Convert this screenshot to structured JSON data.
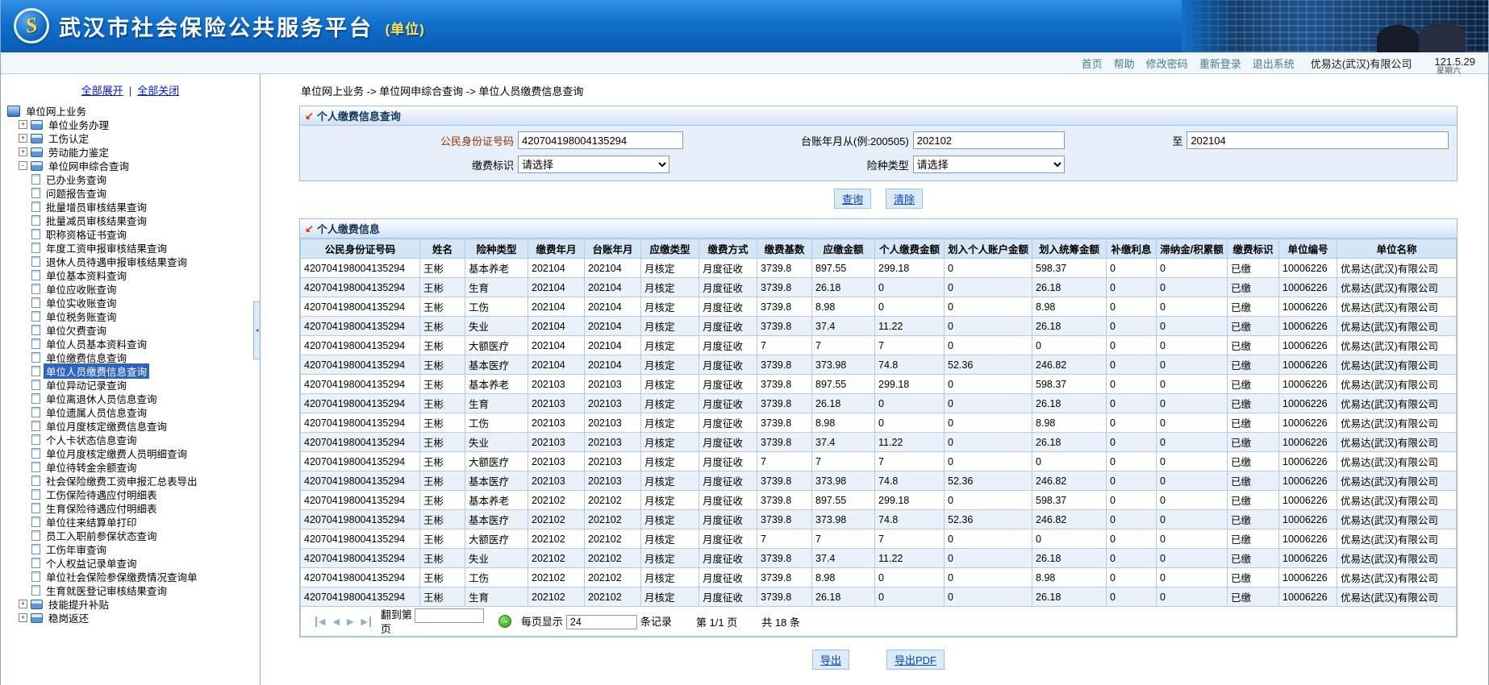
{
  "header": {
    "logo_glyph": "S",
    "title": "武汉市社会保险公共服务平台",
    "title_tag": "(单位)",
    "nav": [
      "首页",
      "帮助",
      "修改密码",
      "重新登录",
      "退出系统"
    ],
    "company": "优易达(武汉)有限公司",
    "version": "121.5.29",
    "weekday": "星期六"
  },
  "sidebar": {
    "expand_all": "全部展开",
    "collapse_all": "全部关闭",
    "root": "单位网上业务",
    "selected_item": "单位人员缴费信息查询",
    "groups": [
      {
        "label": "单位业务办理",
        "expanded": false,
        "children": []
      },
      {
        "label": "工伤认定",
        "expanded": false,
        "children": []
      },
      {
        "label": "劳动能力鉴定",
        "expanded": false,
        "children": []
      },
      {
        "label": "单位网申综合查询",
        "expanded": true,
        "children": [
          "已办业务查询",
          "问题报告查询",
          "批量增员审核结果查询",
          "批量减员审核结果查询",
          "职称资格证书查询",
          "年度工资申报审核结果查询",
          "退休人员待遇申报审核结果查询",
          "单位基本资料查询",
          "单位应收账查询",
          "单位实收账查询",
          "单位税务账查询",
          "单位欠费查询",
          "单位人员基本资料查询",
          "单位缴费信息查询",
          "单位人员缴费信息查询",
          "单位异动记录查询",
          "单位离退休人员信息查询",
          "单位遗属人员信息查询",
          "单位月度核定缴费信息查询",
          "个人卡状态信息查询",
          "单位月度核定缴费人员明细查询",
          "单位待转金余额查询",
          "社会保险缴费工资申报汇总表导出",
          "工伤保险待遇应付明细表",
          "生育保险待遇应付明细表",
          "单位往来结算单打印",
          "员工入职前参保状态查询",
          "工伤年审查询",
          "个人权益记录单查询",
          "单位社会保险参保缴费情况查询单",
          "生育就医登记审核结果查询"
        ]
      },
      {
        "label": "技能提升补贴",
        "expanded": false,
        "children": []
      },
      {
        "label": "稳岗返还",
        "expanded": false,
        "children": []
      }
    ]
  },
  "breadcrumb": {
    "separator": "->",
    "parts": [
      "单位网上业务",
      "单位网申综合查询",
      "单位人员缴费信息查询"
    ]
  },
  "query": {
    "title": "个人缴费信息查询",
    "id_label": "公民身份证号码",
    "id_value": "420704198004135294",
    "period_from_label": "台账年月从(例:200505)",
    "period_from_value": "202102",
    "period_to_label": "至",
    "period_to_value": "202104",
    "pay_flag_label": "缴费标识",
    "pay_flag_value": "请选择",
    "ins_type_label": "险种类型",
    "ins_type_value": "请选择",
    "search_btn": "查询",
    "clear_btn": "清除"
  },
  "results": {
    "title": "个人缴费信息",
    "columns": [
      "公民身份证号码",
      "姓名",
      "险种类型",
      "缴费年月",
      "台账年月",
      "应缴类型",
      "缴费方式",
      "缴费基数",
      "应缴金额",
      "个人缴费金额",
      "划入个人账户金额",
      "划入统筹金额",
      "补缴利息",
      "滞纳金/积累额",
      "缴费标识",
      "单位编号",
      "单位名称"
    ],
    "rows": [
      [
        "420704198004135294",
        "王彬",
        "基本养老",
        "202104",
        "202104",
        "月核定",
        "月度征收",
        "3739.8",
        "897.55",
        "299.18",
        "0",
        "598.37",
        "0",
        "0",
        "已缴",
        "10006226",
        "优易达(武汉)有限公司"
      ],
      [
        "420704198004135294",
        "王彬",
        "生育",
        "202104",
        "202104",
        "月核定",
        "月度征收",
        "3739.8",
        "26.18",
        "0",
        "0",
        "26.18",
        "0",
        "0",
        "已缴",
        "10006226",
        "优易达(武汉)有限公司"
      ],
      [
        "420704198004135294",
        "王彬",
        "工伤",
        "202104",
        "202104",
        "月核定",
        "月度征收",
        "3739.8",
        "8.98",
        "0",
        "0",
        "8.98",
        "0",
        "0",
        "已缴",
        "10006226",
        "优易达(武汉)有限公司"
      ],
      [
        "420704198004135294",
        "王彬",
        "失业",
        "202104",
        "202104",
        "月核定",
        "月度征收",
        "3739.8",
        "37.4",
        "11.22",
        "0",
        "26.18",
        "0",
        "0",
        "已缴",
        "10006226",
        "优易达(武汉)有限公司"
      ],
      [
        "420704198004135294",
        "王彬",
        "大额医疗",
        "202104",
        "202104",
        "月核定",
        "月度征收",
        "7",
        "7",
        "7",
        "0",
        "0",
        "0",
        "0",
        "已缴",
        "10006226",
        "优易达(武汉)有限公司"
      ],
      [
        "420704198004135294",
        "王彬",
        "基本医疗",
        "202104",
        "202104",
        "月核定",
        "月度征收",
        "3739.8",
        "373.98",
        "74.8",
        "52.36",
        "246.82",
        "0",
        "0",
        "已缴",
        "10006226",
        "优易达(武汉)有限公司"
      ],
      [
        "420704198004135294",
        "王彬",
        "基本养老",
        "202103",
        "202103",
        "月核定",
        "月度征收",
        "3739.8",
        "897.55",
        "299.18",
        "0",
        "598.37",
        "0",
        "0",
        "已缴",
        "10006226",
        "优易达(武汉)有限公司"
      ],
      [
        "420704198004135294",
        "王彬",
        "生育",
        "202103",
        "202103",
        "月核定",
        "月度征收",
        "3739.8",
        "26.18",
        "0",
        "0",
        "26.18",
        "0",
        "0",
        "已缴",
        "10006226",
        "优易达(武汉)有限公司"
      ],
      [
        "420704198004135294",
        "王彬",
        "工伤",
        "202103",
        "202103",
        "月核定",
        "月度征收",
        "3739.8",
        "8.98",
        "0",
        "0",
        "8.98",
        "0",
        "0",
        "已缴",
        "10006226",
        "优易达(武汉)有限公司"
      ],
      [
        "420704198004135294",
        "王彬",
        "失业",
        "202103",
        "202103",
        "月核定",
        "月度征收",
        "3739.8",
        "37.4",
        "11.22",
        "0",
        "26.18",
        "0",
        "0",
        "已缴",
        "10006226",
        "优易达(武汉)有限公司"
      ],
      [
        "420704198004135294",
        "王彬",
        "大额医疗",
        "202103",
        "202103",
        "月核定",
        "月度征收",
        "7",
        "7",
        "7",
        "0",
        "0",
        "0",
        "0",
        "已缴",
        "10006226",
        "优易达(武汉)有限公司"
      ],
      [
        "420704198004135294",
        "王彬",
        "基本医疗",
        "202103",
        "202103",
        "月核定",
        "月度征收",
        "3739.8",
        "373.98",
        "74.8",
        "52.36",
        "246.82",
        "0",
        "0",
        "已缴",
        "10006226",
        "优易达(武汉)有限公司"
      ],
      [
        "420704198004135294",
        "王彬",
        "基本养老",
        "202102",
        "202102",
        "月核定",
        "月度征收",
        "3739.8",
        "897.55",
        "299.18",
        "0",
        "598.37",
        "0",
        "0",
        "已缴",
        "10006226",
        "优易达(武汉)有限公司"
      ],
      [
        "420704198004135294",
        "王彬",
        "基本医疗",
        "202102",
        "202102",
        "月核定",
        "月度征收",
        "3739.8",
        "373.98",
        "74.8",
        "52.36",
        "246.82",
        "0",
        "0",
        "已缴",
        "10006226",
        "优易达(武汉)有限公司"
      ],
      [
        "420704198004135294",
        "王彬",
        "大额医疗",
        "202102",
        "202102",
        "月核定",
        "月度征收",
        "7",
        "7",
        "7",
        "0",
        "0",
        "0",
        "0",
        "已缴",
        "10006226",
        "优易达(武汉)有限公司"
      ],
      [
        "420704198004135294",
        "王彬",
        "失业",
        "202102",
        "202102",
        "月核定",
        "月度征收",
        "3739.8",
        "37.4",
        "11.22",
        "0",
        "26.18",
        "0",
        "0",
        "已缴",
        "10006226",
        "优易达(武汉)有限公司"
      ],
      [
        "420704198004135294",
        "王彬",
        "工伤",
        "202102",
        "202102",
        "月核定",
        "月度征收",
        "3739.8",
        "8.98",
        "0",
        "0",
        "8.98",
        "0",
        "0",
        "已缴",
        "10006226",
        "优易达(武汉)有限公司"
      ],
      [
        "420704198004135294",
        "王彬",
        "生育",
        "202102",
        "202102",
        "月核定",
        "月度征收",
        "3739.8",
        "26.18",
        "0",
        "0",
        "26.18",
        "0",
        "0",
        "已缴",
        "10006226",
        "优易达(武汉)有限公司"
      ]
    ]
  },
  "pagination": {
    "goto_prefix": "翻到第",
    "goto_suffix": "页",
    "page_size_label": "每页显示",
    "page_size_value": "24",
    "page_size_suffix": "条记录",
    "page_info": "第 1/1 页",
    "total_info": "共 18 条"
  },
  "export": {
    "excel": "导出",
    "pdf": "导出PDF"
  }
}
